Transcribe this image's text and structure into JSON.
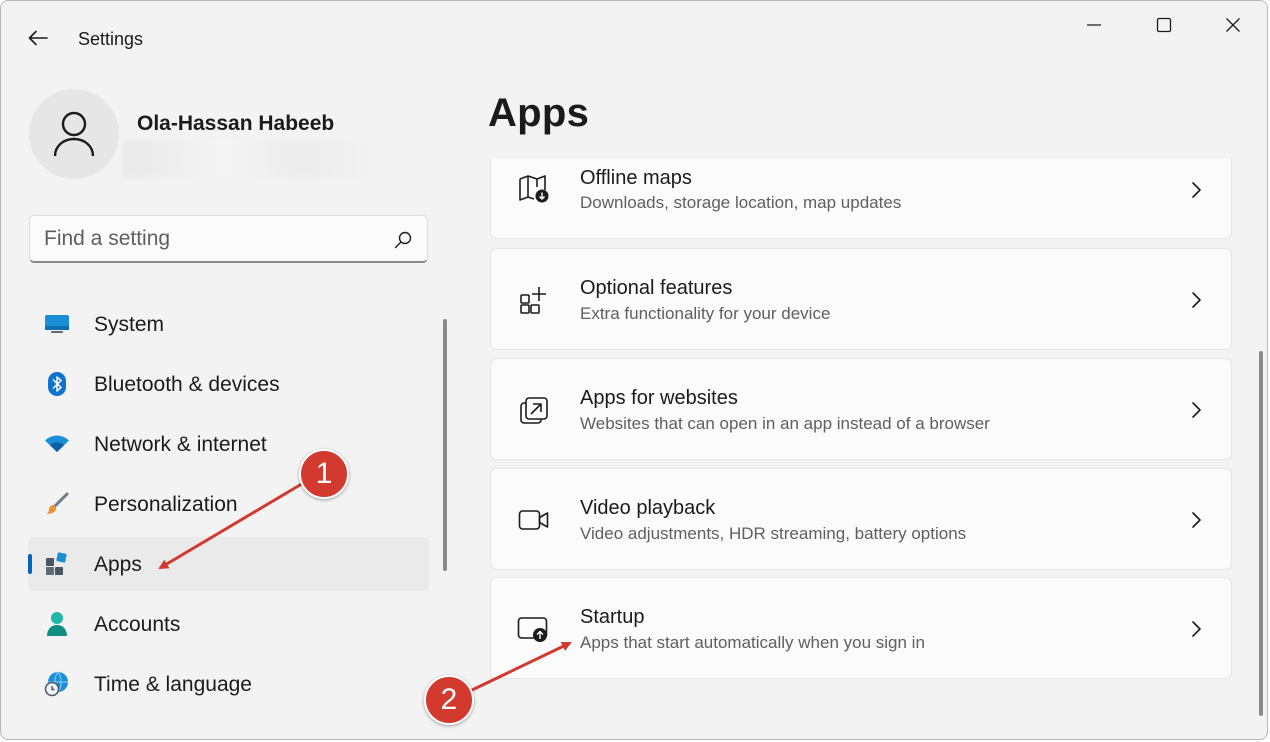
{
  "window": {
    "title": "Settings"
  },
  "user": {
    "name": "Ola-Hassan Habeeb"
  },
  "search": {
    "placeholder": "Find a setting"
  },
  "sidebar": {
    "items": [
      {
        "label": "System",
        "icon": "system-icon"
      },
      {
        "label": "Bluetooth & devices",
        "icon": "bluetooth-icon"
      },
      {
        "label": "Network & internet",
        "icon": "wifi-icon"
      },
      {
        "label": "Personalization",
        "icon": "brush-icon"
      },
      {
        "label": "Apps",
        "icon": "apps-icon",
        "active": true
      },
      {
        "label": "Accounts",
        "icon": "accounts-icon"
      },
      {
        "label": "Time & language",
        "icon": "globe-clock-icon"
      }
    ]
  },
  "main": {
    "title": "Apps",
    "cards": [
      {
        "title": "Offline maps",
        "desc": "Downloads, storage location, map updates",
        "icon": "map-download-icon"
      },
      {
        "title": "Optional features",
        "desc": "Extra functionality for your device",
        "icon": "add-features-icon"
      },
      {
        "title": "Apps for websites",
        "desc": "Websites that can open in an app instead of a browser",
        "icon": "open-link-icon"
      },
      {
        "title": "Video playback",
        "desc": "Video adjustments, HDR streaming, battery options",
        "icon": "video-camera-icon"
      },
      {
        "title": "Startup",
        "desc": "Apps that start automatically when you sign in",
        "icon": "startup-icon"
      }
    ]
  },
  "annotations": {
    "step1": "1",
    "step2": "2",
    "color": "#d23a30"
  },
  "colors": {
    "accent": "#0067c0",
    "background": "#f3f3f3",
    "card": "#fbfbfb"
  }
}
